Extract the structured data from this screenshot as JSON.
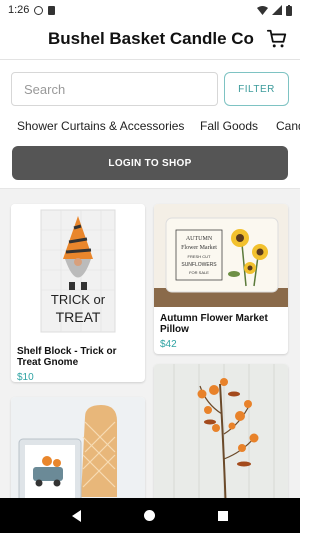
{
  "status_bar": {
    "time": "1:26"
  },
  "header": {
    "title": "Bushel Basket Candle Co"
  },
  "search": {
    "placeholder": "Search"
  },
  "filter_label": "FILTER",
  "categories": [
    "Shower Curtains & Accessories",
    "Fall Goods",
    "Cand"
  ],
  "login_label": "LOGIN TO SHOP",
  "products": [
    {
      "name": "Shelf Block - Trick or Treat Gnome",
      "price": "$10",
      "art_text_1": "TRICK or",
      "art_text_2": "TREAT"
    },
    {
      "name": "Autumn Flower Market Pillow",
      "price": "$42",
      "art_text_1": "AUTUMN",
      "art_text_2": "Flower Market",
      "art_text_3": "FRESH CUT",
      "art_text_4": "SUNFLOWERS",
      "art_text_5": "FOR SALE"
    },
    {
      "name": "",
      "price": ""
    },
    {
      "name": "",
      "price": ""
    }
  ],
  "colors": {
    "accent": "#2fa3a3",
    "login_bg": "#555555",
    "nav_bg": "#000000"
  }
}
